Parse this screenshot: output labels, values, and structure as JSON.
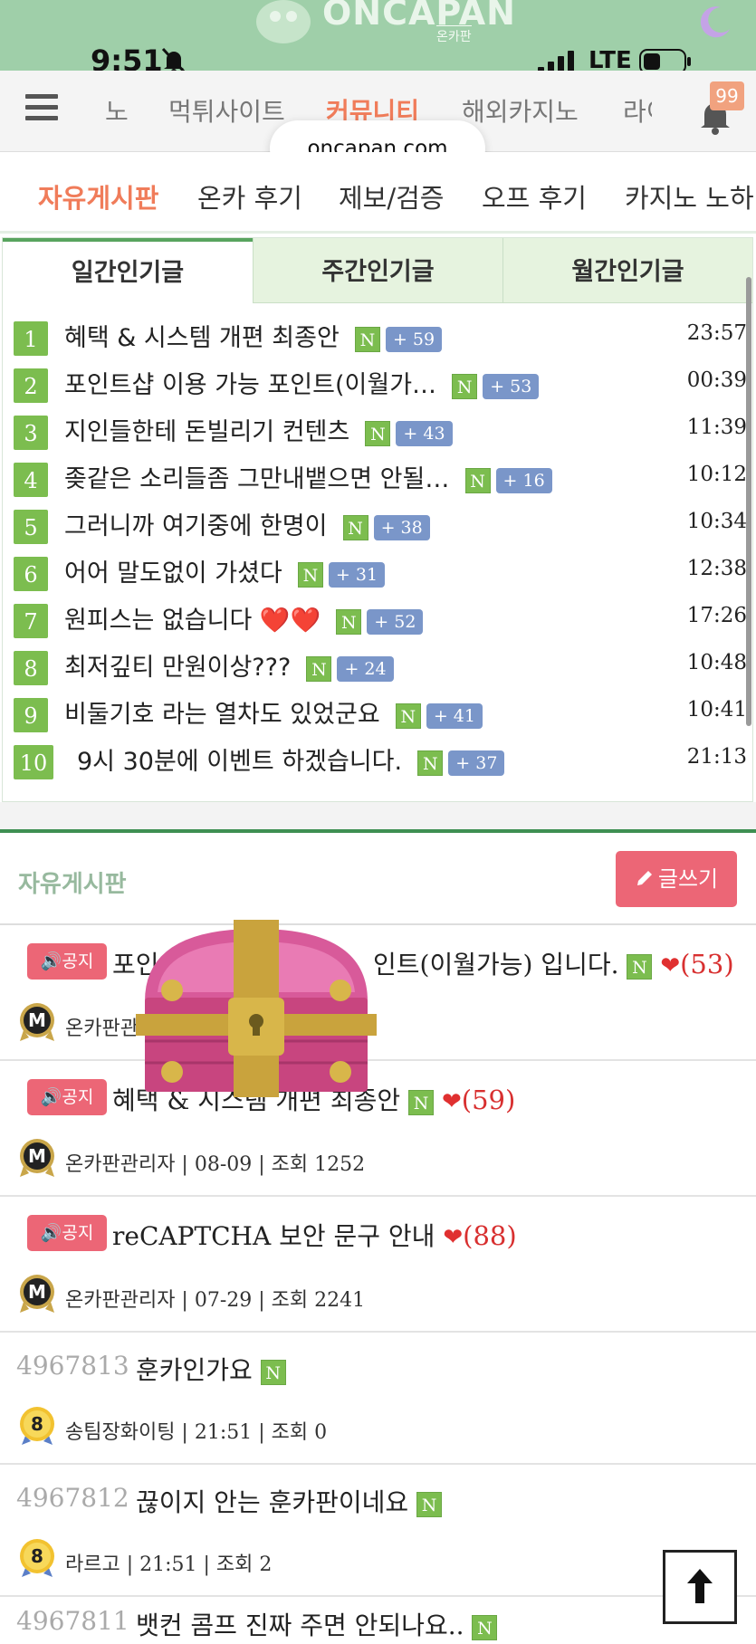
{
  "logo": {
    "wordmark": "ONCAPAN",
    "sub": "온카판"
  },
  "status": {
    "time": "9:51",
    "network": "LTE"
  },
  "nav": {
    "items": [
      {
        "label": "노"
      },
      {
        "label": "먹튀사이트"
      },
      {
        "label": "커뮤니티"
      },
      {
        "label": "해외카지노"
      },
      {
        "label": "라이"
      }
    ],
    "notif_count": "99"
  },
  "url": "oncapan.com",
  "subnav": {
    "items": [
      {
        "label": "자유게시판"
      },
      {
        "label": "온카 후기"
      },
      {
        "label": "제보/검증"
      },
      {
        "label": "오프 후기"
      },
      {
        "label": "카지노 노하"
      }
    ]
  },
  "popular": {
    "tabs": [
      {
        "label": "일간인기글"
      },
      {
        "label": "주간인기글"
      },
      {
        "label": "월간인기글"
      }
    ],
    "new_label": "N",
    "items": [
      {
        "rank": "1",
        "title": "혜택 & 시스템 개편 최종안",
        "count": "+ 59",
        "time": "23:57"
      },
      {
        "rank": "2",
        "title": "포인트샵 이용 가능 포인트(이월가…",
        "count": "+ 53",
        "time": "00:39"
      },
      {
        "rank": "3",
        "title": "지인들한테 돈빌리기 컨텐츠",
        "count": "+ 43",
        "time": "11:39"
      },
      {
        "rank": "4",
        "title": "좆같은 소리들좀 그만내뱉으면 안될…",
        "count": "+ 16",
        "time": "10:12"
      },
      {
        "rank": "5",
        "title": "그러니까 여기중에 한명이",
        "count": "+ 38",
        "time": "10:34"
      },
      {
        "rank": "6",
        "title": "어어 말도없이 가셨다",
        "count": "+ 31",
        "time": "12:38"
      },
      {
        "rank": "7",
        "title": "원피스는 없습니다 ❤️❤️",
        "count": "+ 52",
        "time": "17:26"
      },
      {
        "rank": "8",
        "title": "최저깊티 만원이상???",
        "count": "+ 24",
        "time": "10:48"
      },
      {
        "rank": "9",
        "title": "비둘기호 라는 열차도 있었군요",
        "count": "+ 41",
        "time": "10:41"
      },
      {
        "rank": "10",
        "title": "9시 30분에 이벤트 하겠습니다.",
        "count": "+ 37",
        "time": "21:13"
      }
    ]
  },
  "board": {
    "title": "자유게시판",
    "write_label": "글쓰기",
    "notice_label": "공지",
    "new_label": "N",
    "notices": [
      {
        "title_left": "포인",
        "title_right": "인트(이월가능) 입니다.",
        "likes": "(53)",
        "author": "온카판관리"
      },
      {
        "title": "혜택 & 시스템 개편 최종안",
        "likes": "(59)",
        "meta": "온카판관리자 | 08-09 | 조회 1252"
      },
      {
        "title": "reCAPTCHA 보안 문구 안내",
        "likes": "(88)",
        "meta": "온카판관리자 | 07-29 | 조회 2241"
      }
    ],
    "posts": [
      {
        "id": "4967813",
        "title": "훈카인가요",
        "meta": "송팀장화이팅 | 21:51 | 조회 0",
        "level": "8"
      },
      {
        "id": "4967812",
        "title": "끊이지 안는 훈카판이네요",
        "meta": "라르고 | 21:51 | 조회 2",
        "level": "8"
      },
      {
        "id": "4967811",
        "title": "뱃컨 콤프 진짜 주면 안되나요.."
      }
    ]
  }
}
